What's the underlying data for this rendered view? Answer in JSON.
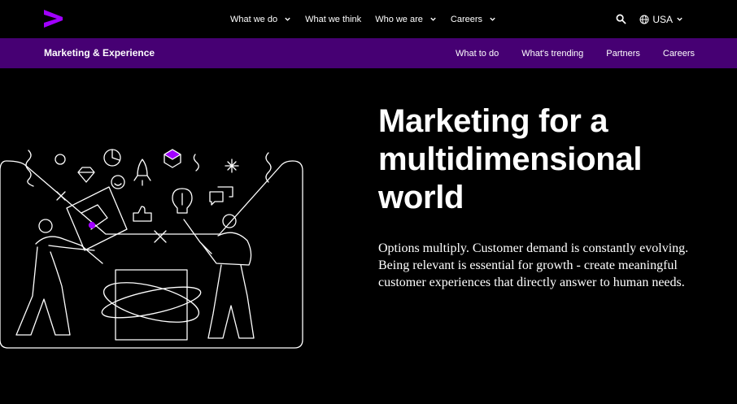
{
  "brand": {
    "logo_icon": "accenture-chevron-logo",
    "accent_color": "#a100ff",
    "subnav_color": "#460073"
  },
  "topnav": {
    "items": [
      {
        "label": "What we do",
        "has_dropdown": true
      },
      {
        "label": "What we think",
        "has_dropdown": false
      },
      {
        "label": "Who we are",
        "has_dropdown": true
      },
      {
        "label": "Careers",
        "has_dropdown": true
      }
    ],
    "search_icon": "search-icon",
    "locale_label": "USA"
  },
  "subnav": {
    "title": "Marketing & Experience",
    "links": [
      "What to do",
      "What's trending",
      "Partners",
      "Careers"
    ]
  },
  "hero": {
    "title_lines": [
      "Marketing for a",
      "multidimensional",
      "world"
    ],
    "description": "Options multiply. Customer demand is constantly evolving. Being relevant is essential for growth - create meaningful customer experiences that directly answer to human needs."
  }
}
